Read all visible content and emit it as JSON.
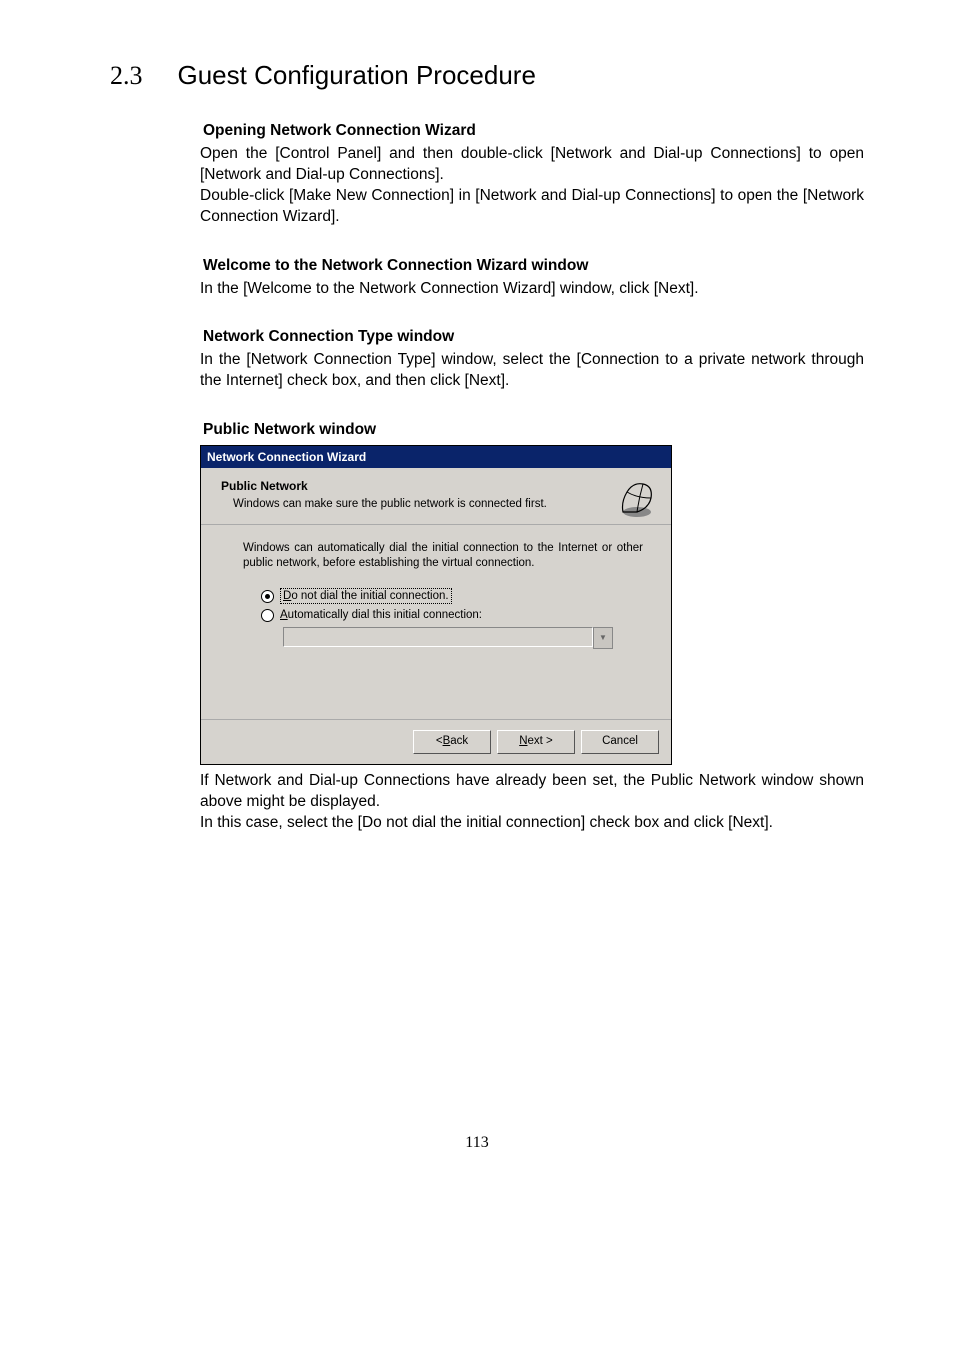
{
  "section": {
    "number": "2.3",
    "title": "Guest Configuration Procedure"
  },
  "blocks": {
    "h1": "Opening Network Connection Wizard",
    "p1a": "Open the [Control Panel] and then double-click [Network and Dial-up Connections] to open [Network and Dial-up Connections].",
    "p1b": "Double-click [Make New Connection] in [Network and Dial-up Connections] to open the [Network Connection Wizard].",
    "h2": "Welcome to the Network Connection Wizard window",
    "p2": "In the [Welcome to the Network Connection Wizard] window, click [Next].",
    "h3": "Network Connection Type window",
    "p3": "In the [Network Connection Type] window, select the [Connection to a private network through the Internet] check box, and then click [Next].",
    "h4": "Public Network window",
    "after1": "If Network and Dial-up Connections have already been set, the Public Network window shown above might be displayed.",
    "after2": "In this case, select the [Do not dial the initial connection] check box and click [Next]."
  },
  "dialog": {
    "title": "Network Connection Wizard",
    "head_bold": "Public Network",
    "head_sub": "Windows can make sure the public network is connected first.",
    "intro": "Windows can automatically dial the initial connection to the Internet or other public network, before establishing the virtual connection.",
    "radio1_pre": "D",
    "radio1_rest": "o not dial the initial connection.",
    "radio2_pre": "A",
    "radio2_rest": "utomatically dial this initial connection:",
    "back_pre": "< ",
    "back_u": "B",
    "back_rest": "ack",
    "next_u": "N",
    "next_rest": "ext >",
    "cancel": "Cancel"
  },
  "pagenum": "113"
}
